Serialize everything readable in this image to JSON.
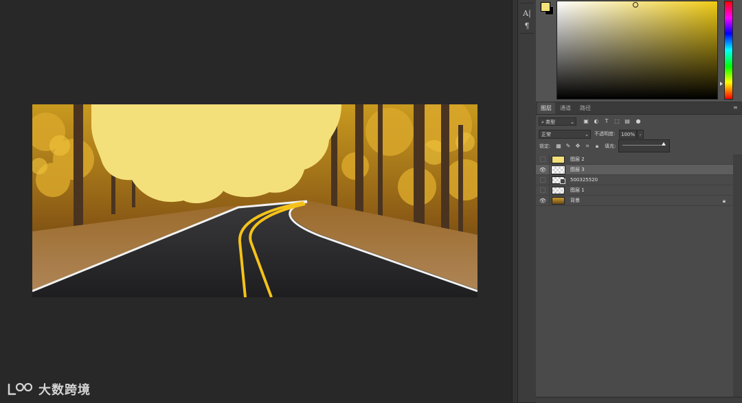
{
  "tools": [
    {
      "name": "type-tool-icon",
      "glyph": "A|"
    },
    {
      "name": "paragraph-icon",
      "glyph": "¶"
    }
  ],
  "color": {
    "foreground": "#f5e079",
    "background": "#000000"
  },
  "layers_panel": {
    "tabs": [
      "图层",
      "通道",
      "路径"
    ],
    "active_tab": "图层",
    "filter_label": "类型",
    "blend_mode": "正常",
    "opacity_label": "不透明度:",
    "opacity_value": "100%",
    "lock_label": "锁定:",
    "fill_label": "填充:",
    "layers": [
      {
        "name": "图层 2",
        "visible": false,
        "selected": false,
        "thumb": "yellow"
      },
      {
        "name": "图层 3",
        "visible": true,
        "selected": true,
        "thumb": "checker"
      },
      {
        "name": "500325520",
        "visible": false,
        "selected": false,
        "thumb": "smart"
      },
      {
        "name": "图层 1",
        "visible": false,
        "selected": false,
        "thumb": "checker"
      },
      {
        "name": "背景",
        "visible": true,
        "selected": false,
        "thumb": "photo",
        "locked": true
      }
    ]
  },
  "watermark": {
    "text": "大数跨境"
  }
}
